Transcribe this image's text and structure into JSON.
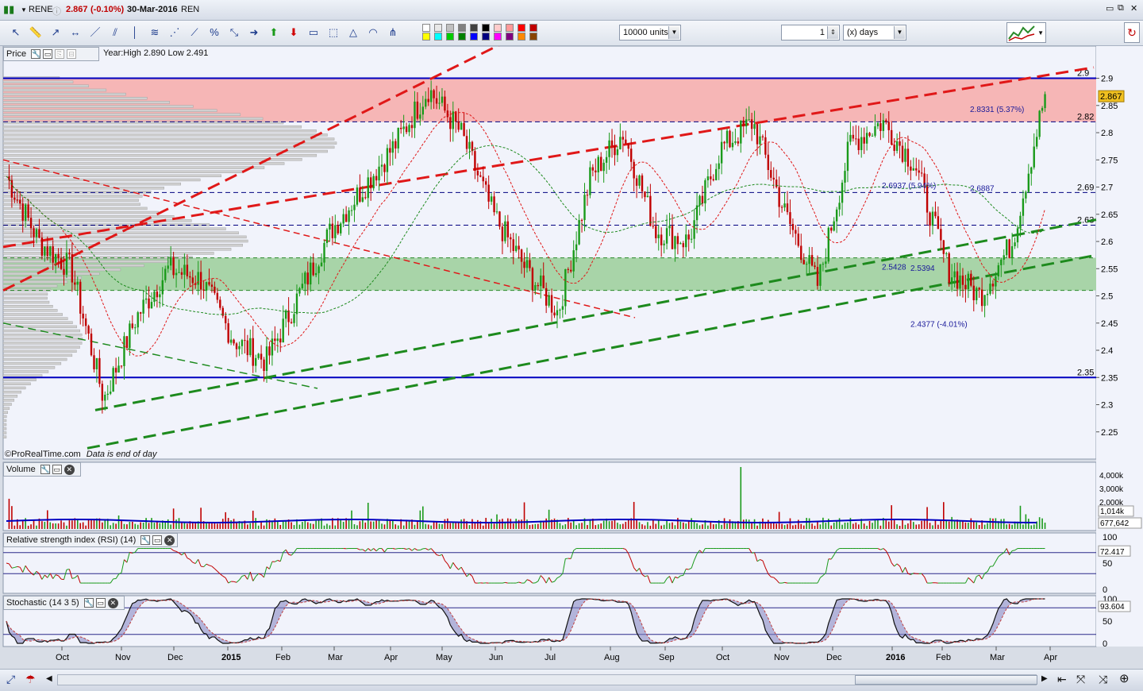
{
  "window": {
    "symbol": "RENE",
    "last_price": "2.867",
    "change": "(-0.10%)",
    "date": "30-Mar-2016",
    "exchange_label": "REN"
  },
  "toolbar": {
    "units_value": "10000 units",
    "period_value": "1",
    "period_unit": "(x) days",
    "tool_icons": [
      "cursor-icon",
      "ruler-icon",
      "line-icon",
      "horizontal-line-icon",
      "trend-line-icon",
      "channel-icon",
      "vertical-line-icon",
      "fibonacci-icon",
      "gann-icon",
      "fan-icon",
      "percent-icon",
      "arrow-icon",
      "arrow-right-icon",
      "arrow-up-icon",
      "arrow-down-icon",
      "rectangle-icon",
      "zone-icon",
      "triangle-icon",
      "arc-icon",
      "pitchfork-icon"
    ],
    "palette": [
      "#ffffff",
      "#e8e8e8",
      "#c0c0c0",
      "#808080",
      "#404040",
      "#000000",
      "#ffcccc",
      "#ff9999",
      "#ff0000",
      "#c00000",
      "#ffff00",
      "#00ffff",
      "#00cc00",
      "#008000",
      "#0000ff",
      "#000080",
      "#ff00ff",
      "#800080",
      "#ff8800",
      "#884400"
    ]
  },
  "price_pane": {
    "label": "Price",
    "info": "Year:High 2.890 Low 2.491",
    "current_label": "2.867",
    "watermark": "©ProRealTime.com",
    "eod_note": "Data is end of day",
    "level_labels": [
      "2.9",
      "2.82",
      "2.69",
      "2.63",
      "2.35"
    ],
    "annotations": [
      "2.8331 (5.37%)",
      "2.6937 (5.94%)",
      "2.6887",
      "2.5428",
      "2.5394",
      "2.4377 (-4.01%)"
    ],
    "resistance_zone": [
      2.82,
      2.9
    ],
    "support_zone": [
      2.51,
      2.57
    ]
  },
  "volume_pane": {
    "label": "Volume",
    "current_label": "1,014k",
    "avg_label": "677,642"
  },
  "rsi_pane": {
    "label": "Relative strength index (RSI) (14)",
    "current_label": "72.417"
  },
  "stoch_pane": {
    "label": "Stochastic (14 3 5)",
    "current_label": "93.604"
  },
  "x_axis_labels": [
    "Oct",
    "Nov",
    "Dec",
    "2015",
    "Feb",
    "Mar",
    "Apr",
    "May",
    "Jun",
    "Jul",
    "Aug",
    "Sep",
    "Oct",
    "Nov",
    "Dec",
    "2016",
    "Feb",
    "Mar",
    "Apr"
  ],
  "chart_data": [
    {
      "type": "line",
      "title": "RENE",
      "xlabel": "",
      "ylabel": "",
      "categories": [
        "Oct",
        "Nov",
        "Dec",
        "2015",
        "Feb",
        "Mar",
        "Apr",
        "May",
        "Jun",
        "Jul",
        "Aug",
        "Sep",
        "Oct",
        "Nov",
        "Dec",
        "2016",
        "Feb",
        "Mar",
        "Apr"
      ],
      "ylim": [
        2.2,
        2.93
      ],
      "yticks": [
        2.25,
        2.3,
        2.35,
        2.4,
        2.45,
        2.5,
        2.55,
        2.6,
        2.65,
        2.7,
        2.75,
        2.8,
        2.85,
        2.9
      ],
      "series": [
        {
          "name": "RENE",
          "values": [
            2.72,
            2.6,
            2.55,
            2.31,
            2.46,
            2.55,
            2.53,
            2.42,
            2.38,
            2.5,
            2.62,
            2.7,
            2.78,
            2.88,
            2.8,
            2.65,
            2.55,
            2.47,
            2.72,
            2.8,
            2.62,
            2.6,
            2.77,
            2.82,
            2.65,
            2.52,
            2.78,
            2.82,
            2.74,
            2.55,
            2.5,
            2.6,
            2.87
          ]
        }
      ],
      "grid": true
    },
    {
      "type": "bar",
      "title": "Volume",
      "yticks_labels": [
        "4,000k",
        "3,000k",
        "2,000k"
      ],
      "ylim": [
        0,
        4500
      ]
    },
    {
      "type": "line",
      "title": "Relative strength index (RSI) (14)",
      "ylim": [
        0,
        100
      ],
      "yticks": [
        0,
        50,
        100
      ],
      "levels": [
        30,
        70
      ]
    },
    {
      "type": "line",
      "title": "Stochastic (14 3 5)",
      "ylim": [
        0,
        100
      ],
      "yticks": [
        0,
        50,
        100
      ],
      "levels": [
        20,
        80
      ]
    }
  ]
}
